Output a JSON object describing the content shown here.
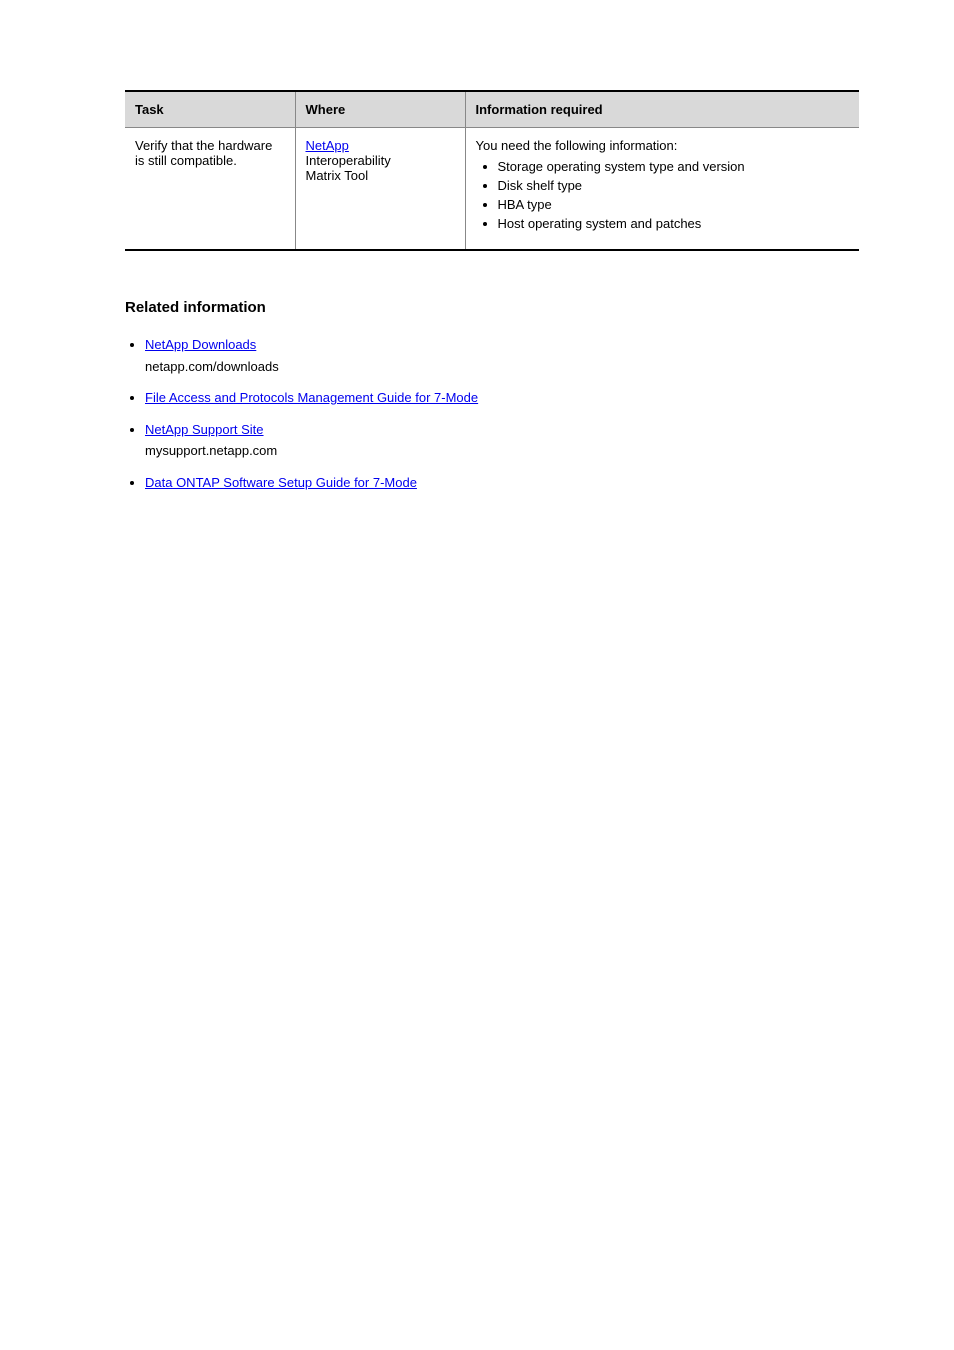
{
  "table": {
    "headers": {
      "col1": "Task",
      "col2": "Where",
      "col3": "Information required"
    },
    "row": {
      "task_line1": "Verify that the hardware",
      "task_line2": "is still compatible.",
      "where_link": "NetApp",
      "where_text1": "Interoperability",
      "where_text2": "Matrix Tool",
      "info_intro": "You need the following information:",
      "info_items": [
        "Storage operating system type and version",
        "Disk shelf type",
        "HBA type",
        "Host operating system and patches"
      ]
    }
  },
  "related": {
    "heading": "Related information",
    "items": [
      {
        "link": "NetApp Downloads",
        "note": "netapp.com/downloads"
      },
      {
        "link": "File Access and Protocols Management Guide for 7-Mode",
        "note": ""
      },
      {
        "link": "NetApp Support Site",
        "note": "mysupport.netapp.com"
      },
      {
        "link": "Data ONTAP Software Setup Guide for 7-Mode",
        "note": ""
      }
    ]
  }
}
